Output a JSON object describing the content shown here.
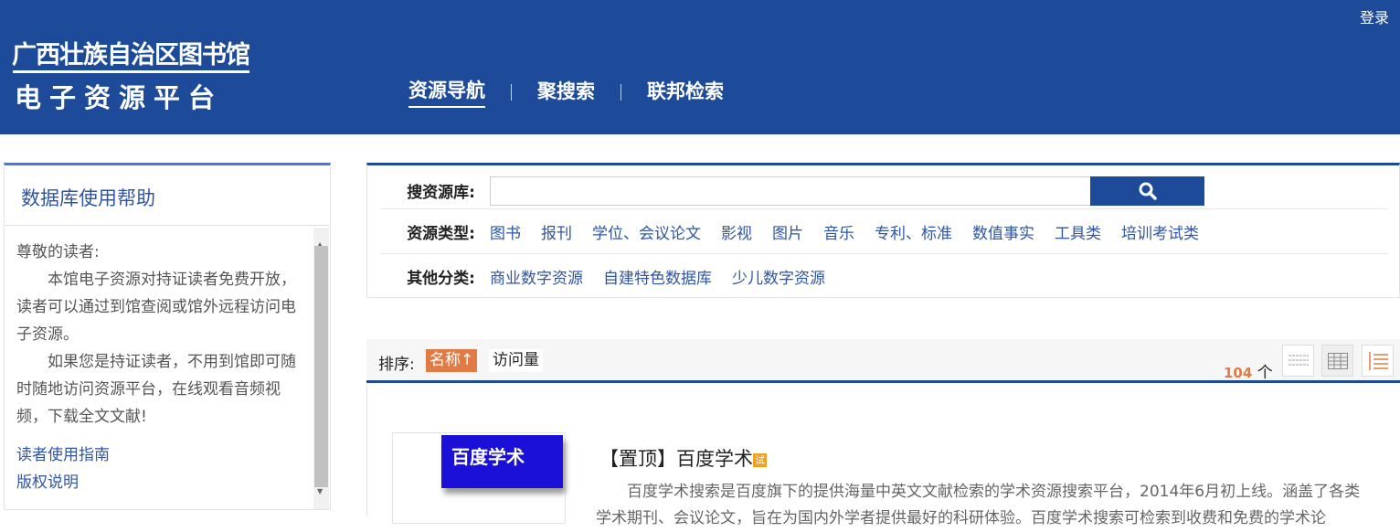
{
  "header": {
    "login": "登录",
    "logo_line1": "广西壮族自治区图书馆",
    "logo_line2": "电子资源平台",
    "nav": [
      {
        "label": "资源导航",
        "active": true
      },
      {
        "label": "聚搜索"
      },
      {
        "label": "联邦检索"
      }
    ]
  },
  "sidebar": {
    "title": "数据库使用帮助",
    "greeting": "尊敬的读者:",
    "para1": "本馆电子资源对持证读者免费开放，读者可以通过到馆查阅或馆外远程访问电子资源。",
    "para2": "如果您是持证读者，不用到馆即可随时随地访问资源平台，在线观看音频视频，下载全文文献!",
    "links": [
      "读者使用指南",
      "版权说明"
    ]
  },
  "search": {
    "label": "搜资源库:",
    "value": "",
    "type_label": "资源类型:",
    "types": [
      "图书",
      "报刊",
      "学位、会议论文",
      "影视",
      "图片",
      "音乐",
      "专利、标准",
      "数值事实",
      "工具类",
      "培训考试类"
    ],
    "other_label": "其他分类:",
    "others": [
      "商业数字资源",
      "自建特色数据库",
      "少儿数字资源"
    ]
  },
  "sort": {
    "label": "排序:",
    "by_name": "名称↑",
    "by_visits": "访问量",
    "count": "104",
    "count_unit": "个"
  },
  "results": [
    {
      "cover": "百度学术",
      "title": "【置顶】百度学术",
      "badge": "试",
      "desc": "百度学术搜索是百度旗下的提供海量中英文文献检索的学术资源搜索平台，2014年6月初上线。涵盖了各类学术期刊、会议论文，旨在为国内外学者提供最好的科研体验。百度学术搜索可检索到收费和免费的学术论"
    }
  ],
  "colors": {
    "brand": "#1d4b99",
    "accent": "#e07b45"
  }
}
